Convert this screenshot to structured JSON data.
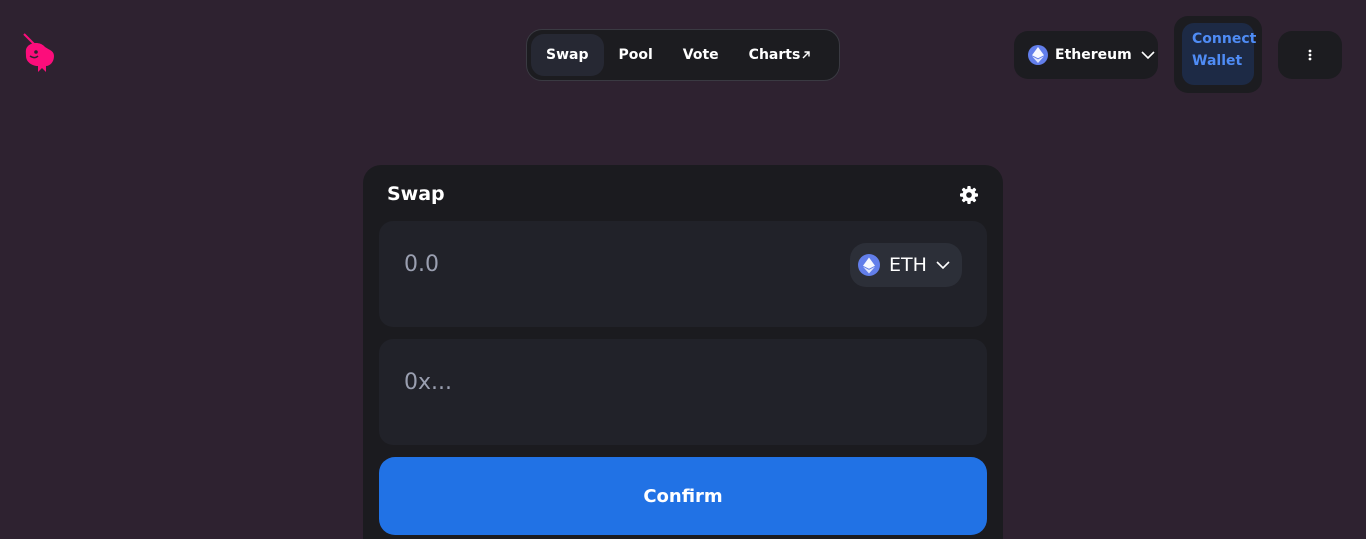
{
  "header": {
    "logo_icon": "uniswap-unicorn-icon",
    "nav_tabs": [
      {
        "label": "Swap",
        "active": true
      },
      {
        "label": "Pool",
        "active": false
      },
      {
        "label": "Vote",
        "active": false
      },
      {
        "label": "Charts",
        "active": false,
        "icon": "external-arrow-icon"
      }
    ],
    "network": {
      "label": "Ethereum",
      "icon": "ethereum-icon"
    },
    "wallet": {
      "line1": "Connect",
      "line2": "Wallet"
    },
    "more_icon": "three-dots-vertical-icon"
  },
  "swap": {
    "title": "Swap",
    "settings_icon": "gear-icon",
    "amount_placeholder": "0.0",
    "token_symbol": "ETH",
    "token_icon": "ethereum-icon",
    "address_placeholder": "0x...",
    "confirm_label": "Confirm"
  },
  "colors": {
    "background": "#2e2230",
    "card": "#1b1b1f",
    "panel": "#212229",
    "accent": "#2172e5",
    "logo_pink": "#fc0d7b",
    "wallet_text": "#4f8cf5"
  }
}
